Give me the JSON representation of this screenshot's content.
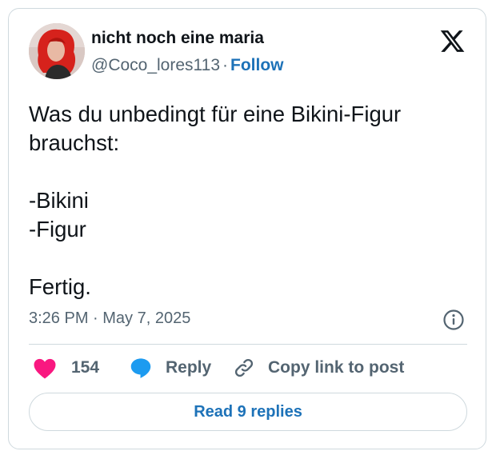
{
  "tweet": {
    "author_name": "nicht noch eine maria",
    "handle": "@Coco_lores113",
    "separator": "·",
    "follow_label": "Follow",
    "text": "Was du unbedingt für eine Bikini-Figur\nbrauchst:\n\n-Bikini\n-Figur\n\nFertig.",
    "timestamp": "3:26 PM · May 7, 2025"
  },
  "actions": {
    "likes_count": "154",
    "reply_label": "Reply",
    "copy_link_label": "Copy link to post"
  },
  "footer": {
    "read_replies_label": "Read 9 replies"
  },
  "icons": {
    "brand": "x-logo-icon",
    "info": "info-icon",
    "like": "heart-icon",
    "reply": "speech-bubble-icon",
    "copy": "link-icon"
  },
  "colors": {
    "like": "#f91880",
    "link_blue": "#1d72b8",
    "reply_blue": "#1d9bf0",
    "muted": "#536471",
    "border": "#cfd9de"
  }
}
